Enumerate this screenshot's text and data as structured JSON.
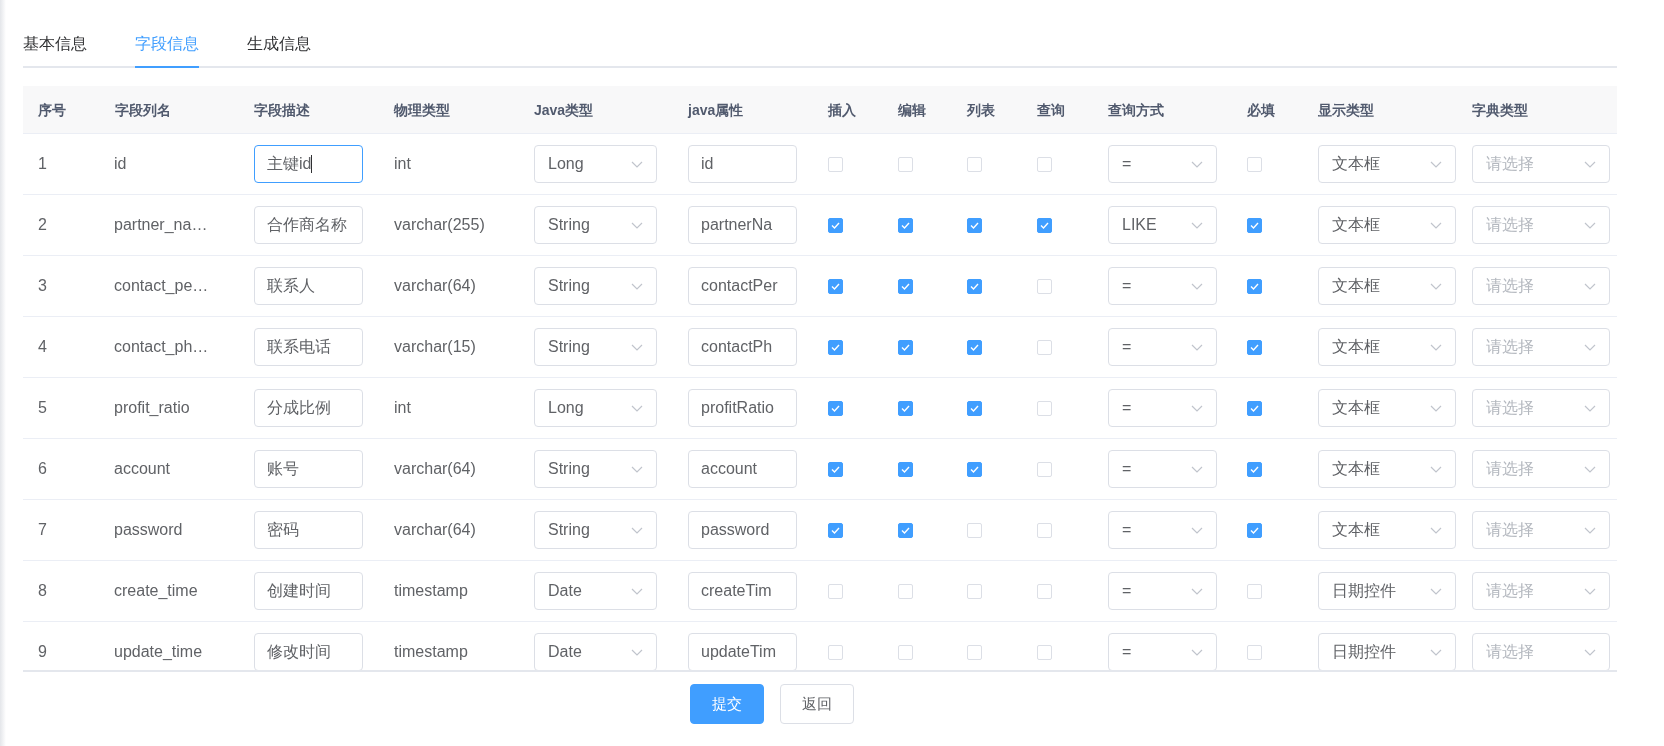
{
  "tabs": [
    {
      "label": "基本信息",
      "selected": false
    },
    {
      "label": "字段信息",
      "selected": true
    },
    {
      "label": "生成信息",
      "selected": false
    }
  ],
  "table": {
    "columns": [
      "序号",
      "字段列名",
      "字段描述",
      "物理类型",
      "Java类型",
      "java属性",
      "插入",
      "编辑",
      "列表",
      "查询",
      "查询方式",
      "必填",
      "显示类型",
      "字典类型"
    ],
    "rows": [
      {
        "index": "1",
        "column_name": "id",
        "description": "主键id",
        "focused": true,
        "physical_type": "int",
        "java_type": "Long",
        "java_field": "id",
        "insert": false,
        "edit": false,
        "list": false,
        "query": false,
        "query_type": "=",
        "required": false,
        "display_type": "文本框",
        "dict_type": {
          "placeholder": "请选择"
        }
      },
      {
        "index": "2",
        "column_name": "partner_na…",
        "description": "合作商名称",
        "focused": false,
        "physical_type": "varchar(255)",
        "java_type": "String",
        "java_field": "partnerNa",
        "insert": true,
        "edit": true,
        "list": true,
        "query": true,
        "query_type": "LIKE",
        "required": true,
        "display_type": "文本框",
        "dict_type": {
          "placeholder": "请选择"
        }
      },
      {
        "index": "3",
        "column_name": "contact_pe…",
        "description": "联系人",
        "focused": false,
        "physical_type": "varchar(64)",
        "java_type": "String",
        "java_field": "contactPer",
        "insert": true,
        "edit": true,
        "list": true,
        "query": false,
        "query_type": "=",
        "required": true,
        "display_type": "文本框",
        "dict_type": {
          "placeholder": "请选择"
        }
      },
      {
        "index": "4",
        "column_name": "contact_ph…",
        "description": "联系电话",
        "focused": false,
        "physical_type": "varchar(15)",
        "java_type": "String",
        "java_field": "contactPh",
        "insert": true,
        "edit": true,
        "list": true,
        "query": false,
        "query_type": "=",
        "required": true,
        "display_type": "文本框",
        "dict_type": {
          "placeholder": "请选择"
        }
      },
      {
        "index": "5",
        "column_name": "profit_ratio",
        "description": "分成比例",
        "focused": false,
        "physical_type": "int",
        "java_type": "Long",
        "java_field": "profitRatio",
        "insert": true,
        "edit": true,
        "list": true,
        "query": false,
        "query_type": "=",
        "required": true,
        "display_type": "文本框",
        "dict_type": {
          "placeholder": "请选择"
        }
      },
      {
        "index": "6",
        "column_name": "account",
        "description": "账号",
        "focused": false,
        "physical_type": "varchar(64)",
        "java_type": "String",
        "java_field": "account",
        "insert": true,
        "edit": true,
        "list": true,
        "query": false,
        "query_type": "=",
        "required": true,
        "display_type": "文本框",
        "dict_type": {
          "placeholder": "请选择"
        }
      },
      {
        "index": "7",
        "column_name": "password",
        "description": "密码",
        "focused": false,
        "physical_type": "varchar(64)",
        "java_type": "String",
        "java_field": "password",
        "insert": true,
        "edit": true,
        "list": false,
        "query": false,
        "query_type": "=",
        "required": true,
        "display_type": "文本框",
        "dict_type": {
          "placeholder": "请选择"
        }
      },
      {
        "index": "8",
        "column_name": "create_time",
        "description": "创建时间",
        "focused": false,
        "physical_type": "timestamp",
        "java_type": "Date",
        "java_field": "createTim",
        "insert": false,
        "edit": false,
        "list": false,
        "query": false,
        "query_type": "=",
        "required": false,
        "display_type": "日期控件",
        "dict_type": {
          "placeholder": "请选择"
        }
      },
      {
        "index": "9",
        "column_name": "update_time",
        "description": "修改时间",
        "focused": false,
        "physical_type": "timestamp",
        "java_type": "Date",
        "java_field": "updateTim",
        "insert": false,
        "edit": false,
        "list": false,
        "query": false,
        "query_type": "=",
        "required": false,
        "display_type": "日期控件",
        "dict_type": {
          "placeholder": "请选择"
        }
      }
    ]
  },
  "buttons": [
    {
      "label": "提交",
      "kind": "primary"
    },
    {
      "label": "返回",
      "kind": "default"
    }
  ]
}
